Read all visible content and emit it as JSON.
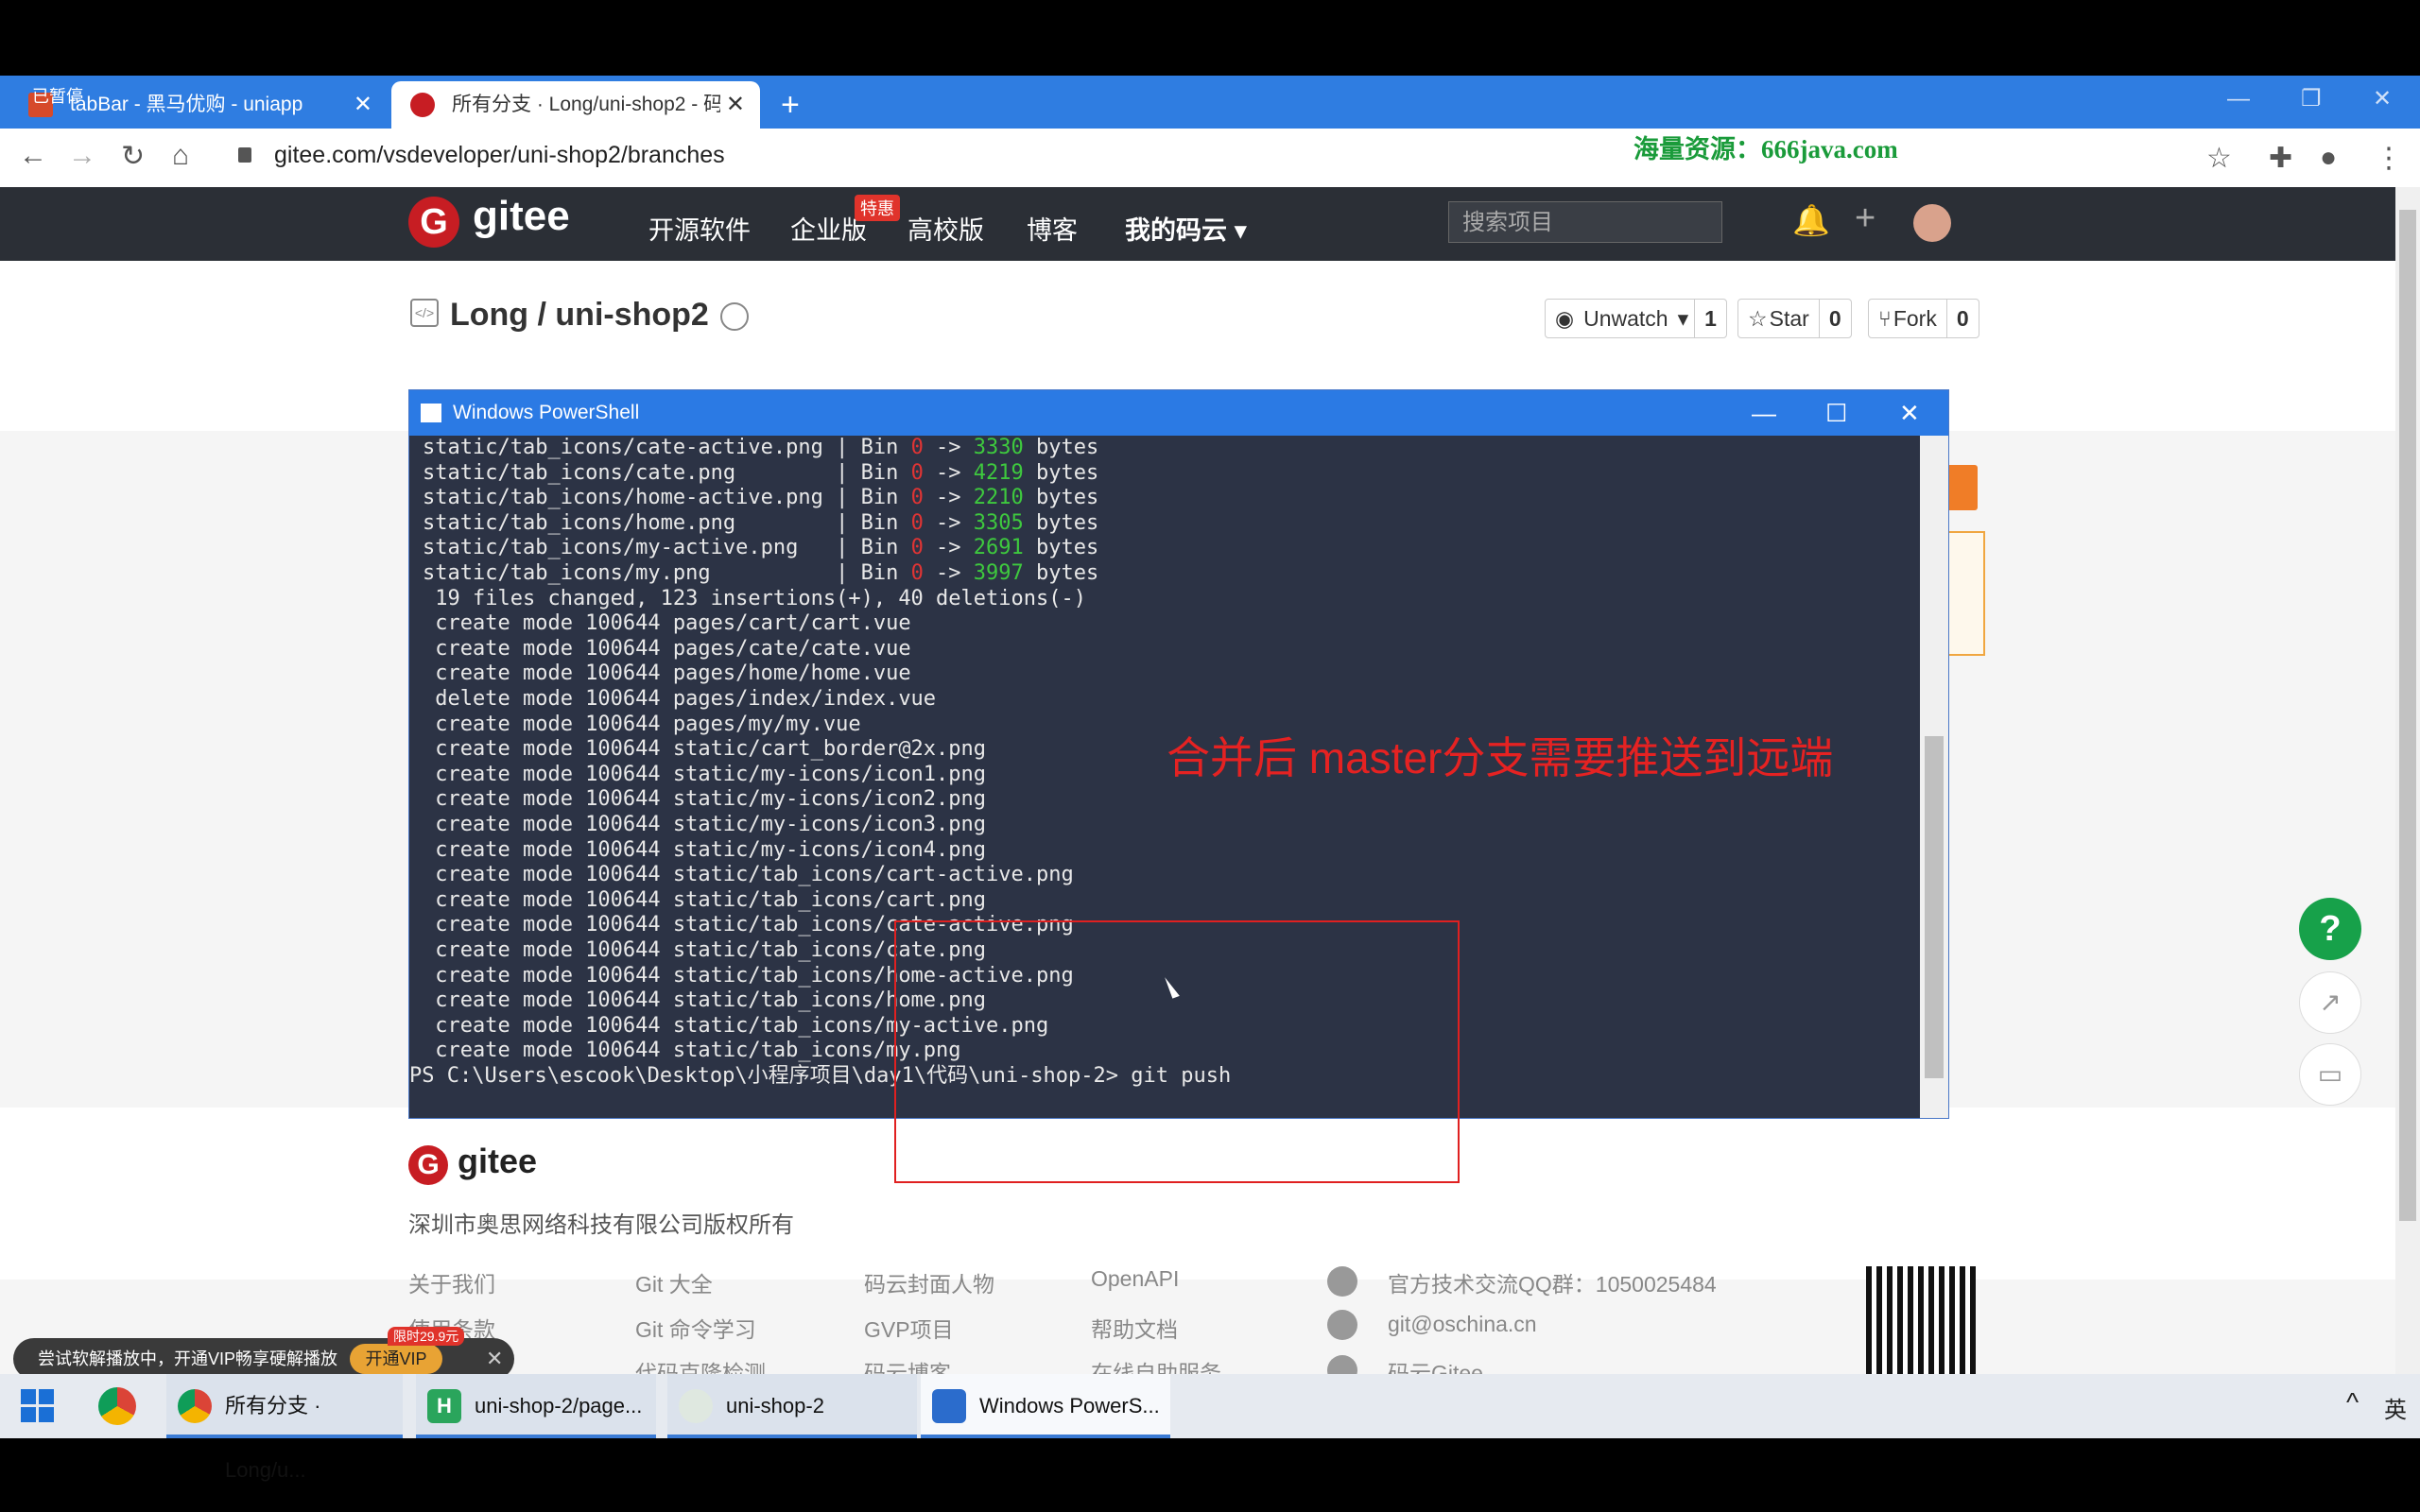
{
  "browser": {
    "tabs": [
      {
        "title": "tabBar - 黑马优购 - uniapp",
        "active": false
      },
      {
        "title": "所有分支 · Long/uni-shop2 - 码云",
        "active": true
      }
    ],
    "tab_overlay_text": "已暂停",
    "new_tab": "+",
    "url": "gitee.com/vsdeveloper/uni-shop2/branches",
    "watermark": "海量资源：666java.com"
  },
  "gitee": {
    "logo_letter": "G",
    "brand": "gitee",
    "nav": [
      "开源软件",
      "企业版",
      "高校版",
      "博客",
      "我的码云"
    ],
    "special_badge": "特惠",
    "search_placeholder": "搜索项目",
    "repo": {
      "owner": "Long",
      "name": "uni-shop2",
      "title": "Long / uni-shop2"
    },
    "watch": {
      "label": "Unwatch",
      "count": "1"
    },
    "star": {
      "label": "Star",
      "count": "0"
    },
    "fork": {
      "label": "Fork",
      "count": "0"
    },
    "footer": {
      "brand": "gitee",
      "copyright": "深圳市奥思网络科技有限公司版权所有",
      "col1": [
        "关于我们",
        "使用条款"
      ],
      "col2": [
        "Git 大全",
        "Git 命令学习",
        "代码克隆检测"
      ],
      "col3": [
        "码云封面人物",
        "GVP项目",
        "码云博客"
      ],
      "col4": [
        "OpenAPI",
        "帮助文档",
        "在线自助服务"
      ],
      "contact": [
        "官方技术交流QQ群：1050025484",
        "git@oschina.cn",
        "码云Gitee"
      ]
    },
    "help_label": "?"
  },
  "powershell": {
    "title": "Windows PowerShell",
    "bin_lines": [
      {
        "file": "static/tab_icons/cate-active.png",
        "from": "0",
        "to": "3330"
      },
      {
        "file": "static/tab_icons/cate.png",
        "from": "0",
        "to": "4219"
      },
      {
        "file": "static/tab_icons/home-active.png",
        "from": "0",
        "to": "2210"
      },
      {
        "file": "static/tab_icons/home.png",
        "from": "0",
        "to": "3305"
      },
      {
        "file": "static/tab_icons/my-active.png",
        "from": "0",
        "to": "2691"
      },
      {
        "file": "static/tab_icons/my.png",
        "from": "0",
        "to": "3997"
      }
    ],
    "summary": "19 files changed, 123 insertions(+), 40 deletions(-)",
    "mode_lines": [
      "create mode 100644 pages/cart/cart.vue",
      "create mode 100644 pages/cate/cate.vue",
      "create mode 100644 pages/home/home.vue",
      "delete mode 100644 pages/index/index.vue",
      "create mode 100644 pages/my/my.vue",
      "create mode 100644 static/cart_border@2x.png",
      "create mode 100644 static/my-icons/icon1.png",
      "create mode 100644 static/my-icons/icon2.png",
      "create mode 100644 static/my-icons/icon3.png",
      "create mode 100644 static/my-icons/icon4.png",
      "create mode 100644 static/tab_icons/cart-active.png",
      "create mode 100644 static/tab_icons/cart.png",
      "create mode 100644 static/tab_icons/cate-active.png",
      "create mode 100644 static/tab_icons/cate.png",
      "create mode 100644 static/tab_icons/home-active.png",
      "create mode 100644 static/tab_icons/home.png",
      "create mode 100644 static/tab_icons/my-active.png",
      "create mode 100644 static/tab_icons/my.png"
    ],
    "prompt": "PS C:\\Users\\escook\\Desktop\\小程序项目\\day1\\代码\\uni-shop-2> ",
    "command": "git push",
    "bin_word": "Bin",
    "arrow": "->",
    "bytes_word": "bytes"
  },
  "annotation": "合并后 master分支需要推送到远端",
  "vip_popup": {
    "text": "尝试软解播放中，开通VIP畅享硬解播放",
    "button": "开通VIP",
    "tag": "限时29.9元"
  },
  "taskbar": {
    "items": [
      "所有分支 · Long/u...",
      "uni-shop-2/page...",
      "uni-shop-2",
      "Windows PowerS..."
    ],
    "tray_text": "英"
  },
  "colors": {
    "gitee_red": "#c71d23",
    "ps_bg": "#2c3345",
    "annotation": "#e52222",
    "tabbar": "#2f7de1"
  }
}
